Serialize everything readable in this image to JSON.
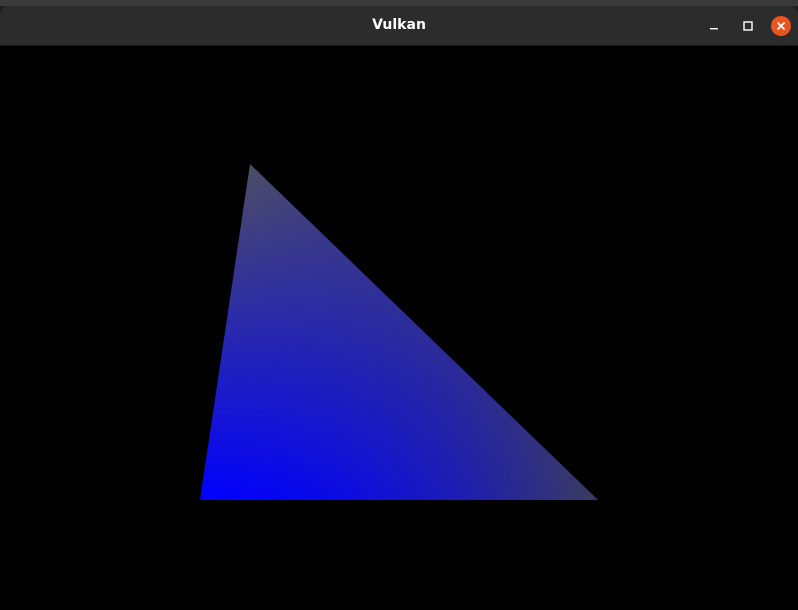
{
  "window": {
    "title": "Vulkan",
    "controls": {
      "minimize_icon": "minimize-icon",
      "maximize_icon": "maximize-icon",
      "close_icon": "close-icon",
      "close_color": "#e95420"
    }
  },
  "scene": {
    "background": "#000000",
    "triangle": {
      "vertex_colors": [
        "#555555",
        "#0000ff",
        "#444444"
      ]
    }
  }
}
